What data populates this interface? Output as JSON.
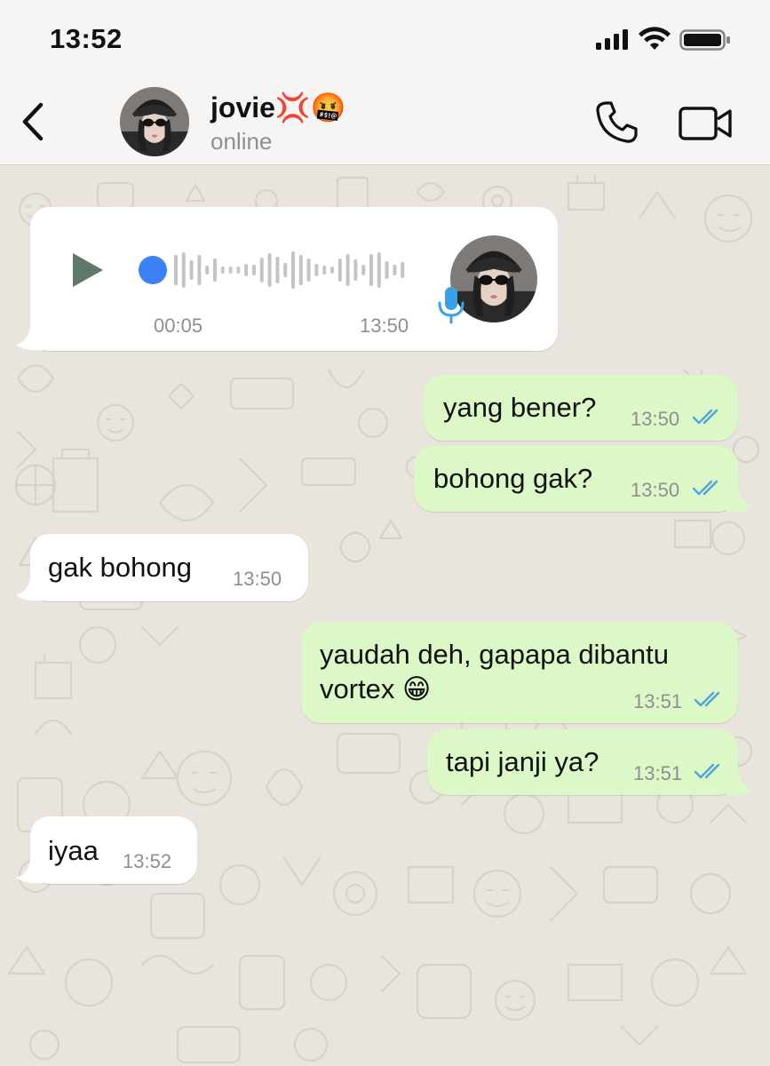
{
  "status_bar": {
    "time": "13:52"
  },
  "header": {
    "contact_name": "jovie💢🤬",
    "contact_status": "online"
  },
  "messages": [
    {
      "type": "voice",
      "direction": "incoming",
      "duration": "00:05",
      "time": "13:50"
    },
    {
      "type": "text",
      "direction": "outgoing",
      "text": "yang bener?",
      "time": "13:50",
      "read": true
    },
    {
      "type": "text",
      "direction": "outgoing",
      "text": "bohong gak?",
      "time": "13:50",
      "read": true
    },
    {
      "type": "text",
      "direction": "incoming",
      "text": "gak bohong",
      "time": "13:50"
    },
    {
      "type": "text",
      "direction": "outgoing",
      "text_line1": "yaudah deh, gapapa dibantu",
      "text_line2": "vortex 😁",
      "time": "13:51",
      "read": true
    },
    {
      "type": "text",
      "direction": "outgoing",
      "text": "tapi janji ya?",
      "time": "13:51",
      "read": true
    },
    {
      "type": "text",
      "direction": "incoming",
      "text": "iyaa",
      "time": "13:52"
    }
  ],
  "colors": {
    "incoming_bubble": "#ffffff",
    "outgoing_bubble": "#dcf8c6",
    "read_ticks": "#4fa3e0",
    "voice_dot": "#3b82f6",
    "play_icon": "#5f7a6b",
    "mic_icon": "#3aa0e8"
  },
  "icons": {
    "back": "chevron-left-icon",
    "call": "phone-icon",
    "video": "video-camera-icon",
    "play": "play-icon",
    "mic": "microphone-icon",
    "ticks": "double-check-icon"
  }
}
